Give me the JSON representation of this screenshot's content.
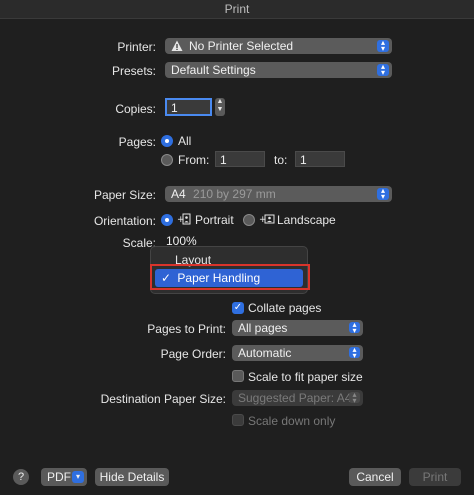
{
  "window": {
    "title": "Print"
  },
  "printer": {
    "label": "Printer:",
    "value": "No Printer Selected",
    "icon": "warning-icon"
  },
  "presets": {
    "label": "Presets:",
    "value": "Default Settings"
  },
  "copies": {
    "label": "Copies:",
    "value": "1"
  },
  "pages": {
    "label": "Pages:",
    "all_label": "All",
    "from_label": "From:",
    "from_value": "1",
    "to_label": "to:",
    "to_value": "1",
    "selected": "all"
  },
  "paper_size": {
    "label": "Paper Size:",
    "value": "A4",
    "detail": "210 by 297 mm"
  },
  "orientation": {
    "label": "Orientation:",
    "portrait_label": "Portrait",
    "landscape_label": "Landscape",
    "selected": "portrait"
  },
  "scale": {
    "label": "Scale:",
    "value": "100%"
  },
  "menu": {
    "items": [
      {
        "label": "Layout",
        "checked": false
      },
      {
        "label": "Paper Handling",
        "checked": true,
        "check_mark": "✓"
      }
    ],
    "highlight_color": "#d9342b"
  },
  "paper_handling": {
    "collate_label": "Collate pages",
    "collate_checked": true,
    "pages_to_print_label": "Pages to Print:",
    "pages_to_print_value": "All pages",
    "page_order_label": "Page Order:",
    "page_order_value": "Automatic",
    "scale_to_fit_label": "Scale to fit paper size",
    "scale_to_fit_checked": false,
    "destination_label": "Destination Paper Size:",
    "destination_value": "Suggested Paper: A4",
    "scale_down_label": "Scale down only",
    "scale_down_checked": false
  },
  "footer": {
    "help_label": "?",
    "pdf_label": "PDF",
    "hide_details_label": "Hide Details",
    "cancel_label": "Cancel",
    "print_label": "Print"
  },
  "colors": {
    "accent": "#2f6fe0",
    "background": "#1f1f1f"
  }
}
